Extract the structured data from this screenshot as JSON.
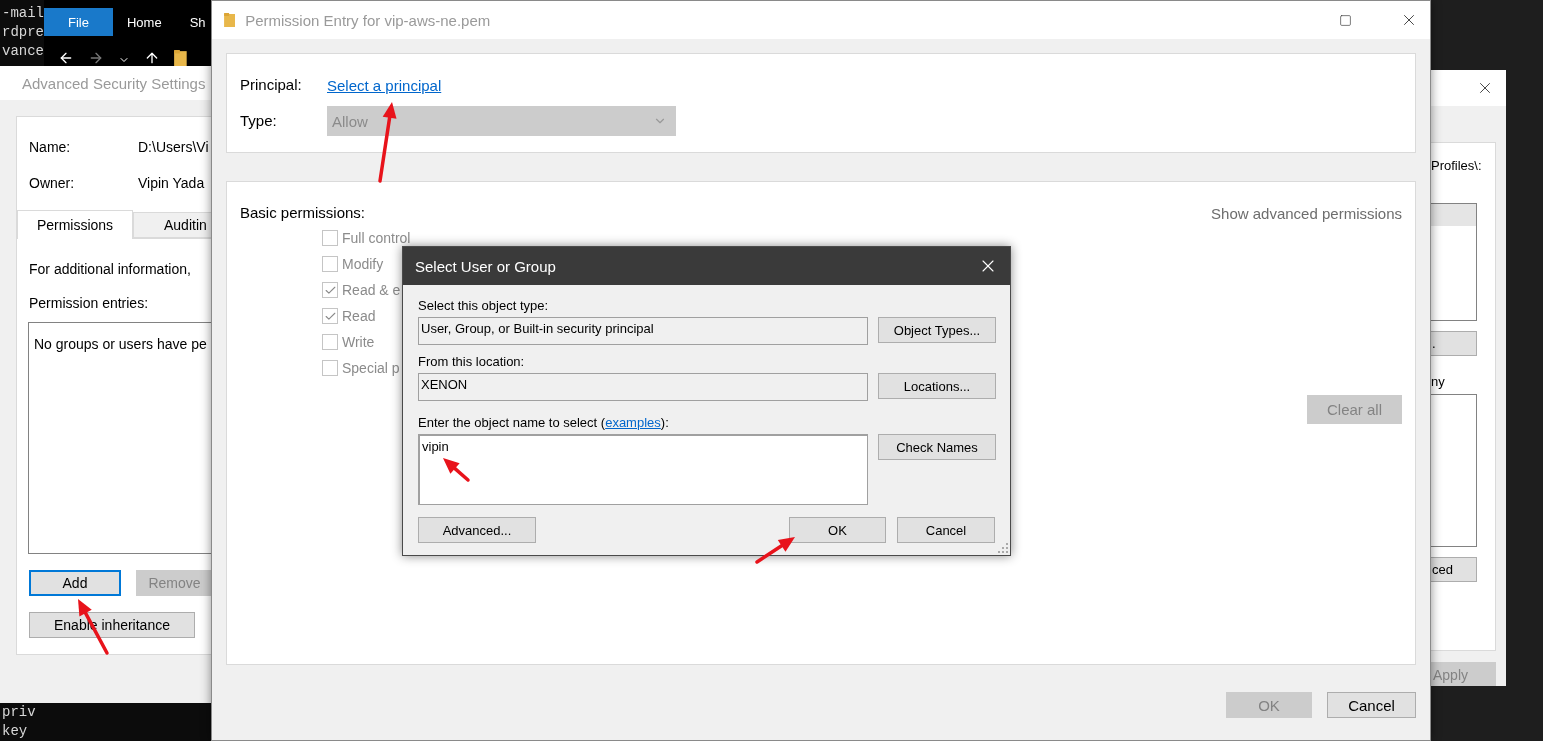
{
  "terminal": {
    "lines_top": [
      "-mail",
      "rdpre",
      "vance"
    ],
    "lines_bottom": [
      "priv",
      "key"
    ]
  },
  "explorer": {
    "tabs": [
      {
        "label": "File",
        "selected": true
      },
      {
        "label": "Home",
        "selected": false
      },
      {
        "label": "Sh",
        "selected": false
      }
    ]
  },
  "advanced_security": {
    "title": "Advanced Security Settings",
    "fields": [
      {
        "label": "Name:",
        "value": "D:\\Users\\Vi"
      },
      {
        "label": "Owner:",
        "value": "Vipin Yada"
      }
    ],
    "tabs": [
      {
        "label": "Permissions",
        "selected": true
      },
      {
        "label": "Auditin",
        "selected": false
      }
    ],
    "info_text": "For additional information,",
    "entries_label": "Permission entries:",
    "entries_empty_text": "No groups or users have pe",
    "buttons": [
      {
        "label": "Add",
        "disabled": false,
        "focused": true
      },
      {
        "label": "Remove",
        "disabled": true,
        "focused": false
      }
    ],
    "inheritance_button": "Enable inheritance"
  },
  "back_window": {
    "path_text": "Profiles\\:",
    "button_1": ".",
    "label": "ny",
    "button_2": "ced",
    "apply": {
      "label": "Apply",
      "disabled": true
    }
  },
  "permission_entry": {
    "title": "Permission Entry for vip-aws-ne.pem",
    "principal_label": "Principal:",
    "principal_link": "Select a principal",
    "type_label": "Type:",
    "type_value": "Allow",
    "type_disabled": true,
    "basic_label": "Basic permissions:",
    "advanced_link": "Show advanced permissions",
    "permissions": [
      {
        "label": "Full control",
        "checked": false,
        "disabled": true
      },
      {
        "label": "Modify",
        "checked": false,
        "disabled": true
      },
      {
        "label": "Read & e",
        "checked": true,
        "disabled": true
      },
      {
        "label": "Read",
        "checked": true,
        "disabled": true
      },
      {
        "label": "Write",
        "checked": false,
        "disabled": true
      },
      {
        "label": "Special p",
        "checked": false,
        "disabled": true
      }
    ],
    "clear_all": {
      "label": "Clear all",
      "disabled": true
    },
    "footer_buttons": [
      {
        "label": "OK",
        "disabled": true
      },
      {
        "label": "Cancel",
        "disabled": false
      }
    ]
  },
  "select_dialog": {
    "title": "Select User or Group",
    "object_type_label": "Select this object type:",
    "object_type_value": "User, Group, or Built-in security principal",
    "object_types_button": "Object Types...",
    "location_label": "From this location:",
    "location_value": "XENON",
    "locations_button": "Locations...",
    "name_label": {
      "before": "Enter the object name to select (",
      "link": "examples",
      "after": "):"
    },
    "name_value": "vipin",
    "check_names_button": "Check Names",
    "advanced_button": "Advanced...",
    "ok_button": "OK",
    "cancel_button": "Cancel"
  }
}
